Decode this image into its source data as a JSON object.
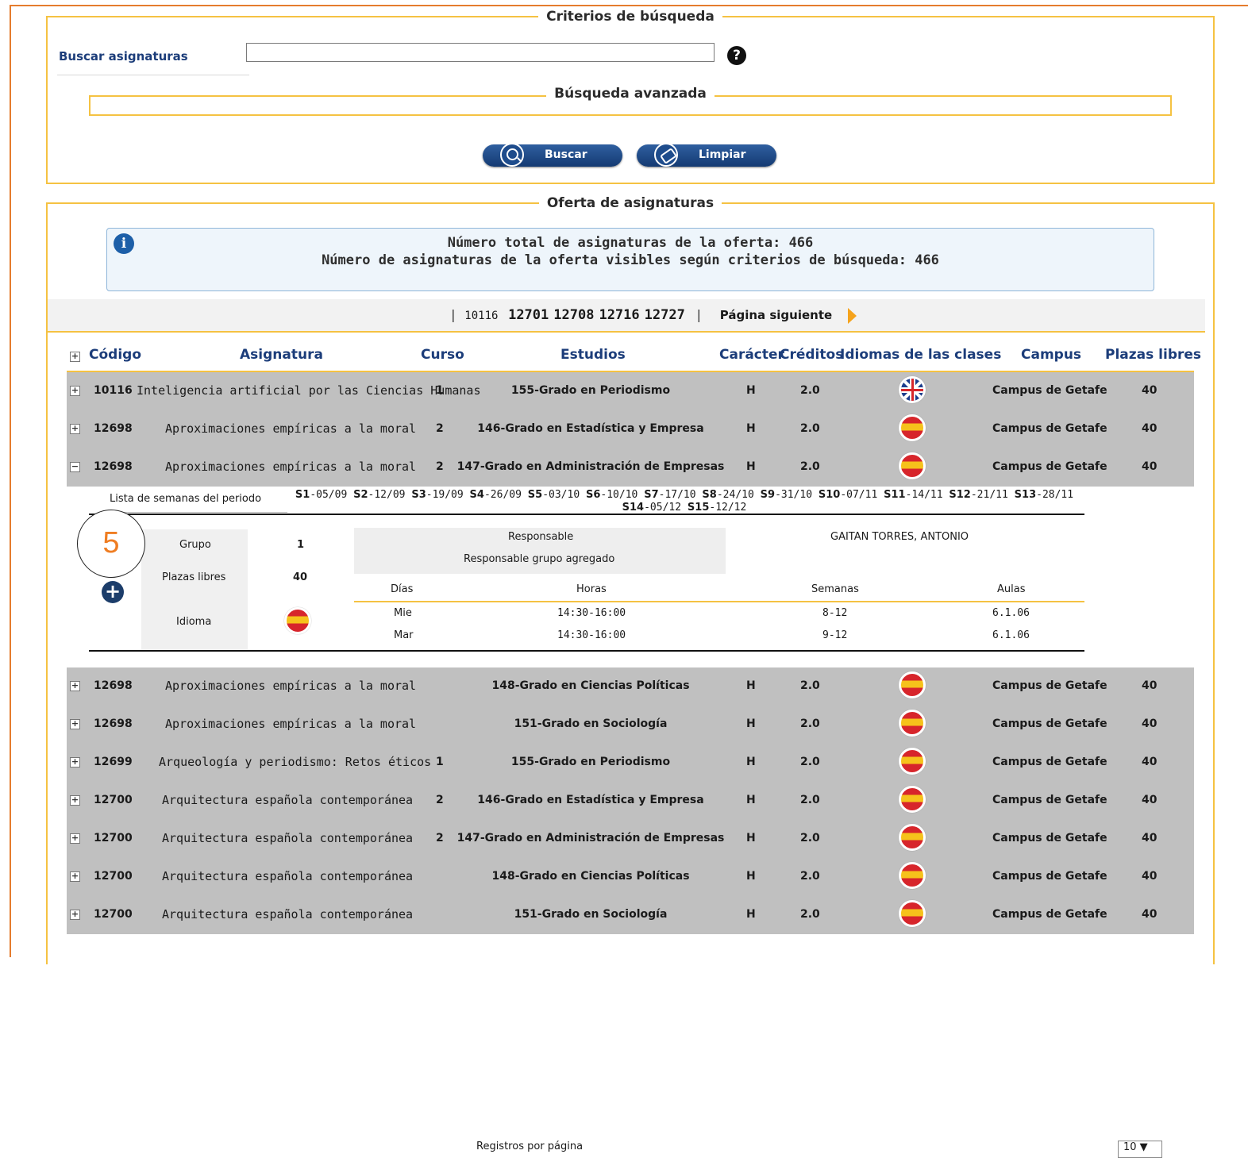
{
  "criteria": {
    "title": "Criterios de búsqueda",
    "search_label": "Buscar asignaturas",
    "search_value": "",
    "help": "?",
    "advanced_title": "Búsqueda avanzada",
    "btn_search": "Buscar",
    "btn_clear": "Limpiar"
  },
  "offer": {
    "title": "Oferta de asignaturas",
    "info_line1": "Número total de asignaturas de la oferta: 466",
    "info_line2": "Número de asignaturas de la oferta visibles según criterios de búsqueda: 466",
    "info_icon": "i",
    "pager": {
      "current": "10116",
      "pages": [
        "12701",
        "12708",
        "12716",
        "12727"
      ],
      "next": "Página siguiente"
    },
    "columns": [
      "Código",
      "Asignatura",
      "Curso",
      "Estudios",
      "Carácter",
      "Créditos",
      "Idiomas de las clases",
      "Campus",
      "Plazas libres"
    ],
    "rows_top": [
      {
        "expander": "+",
        "code": "10116",
        "name": "Inteligencia artificial por las Ciencias Humanas",
        "curso": "1",
        "estudios": "155-Grado en Periodismo",
        "caracter": "H",
        "creditos": "2.0",
        "idioma": "en-flag-icon",
        "campus": "Campus de Getafe",
        "plazas": "40"
      },
      {
        "expander": "+",
        "code": "12698",
        "name": "Aproximaciones empíricas a la moral",
        "curso": "2",
        "estudios": "146-Grado en Estadística y Empresa",
        "caracter": "H",
        "creditos": "2.0",
        "idioma": "es-flag-icon",
        "campus": "Campus de Getafe",
        "plazas": "40"
      },
      {
        "expander": "−",
        "code": "12698",
        "name": "Aproximaciones empíricas a la moral",
        "curso": "2",
        "estudios": "147-Grado en Administración de Empresas",
        "caracter": "H",
        "creditos": "2.0",
        "idioma": "es-flag-icon",
        "campus": "Campus de Getafe",
        "plazas": "40"
      }
    ],
    "detail": {
      "weeks_label": "Lista de semanas del periodo",
      "weeks_line1": [
        "S1",
        "-05/09",
        "S2",
        "-12/09",
        "S3",
        "-19/09",
        "S4",
        "-26/09",
        "S5",
        "-03/10",
        "S6",
        "-10/10",
        "S7",
        "-17/10",
        "S8",
        "-24/10",
        "S9",
        "-31/10",
        "S10",
        "-07/11",
        "S11",
        "-14/11",
        "S12",
        "-21/11",
        "S13",
        "-28/11"
      ],
      "weeks_line2": [
        "S14",
        "-05/12",
        "S15",
        "-12/12"
      ],
      "grupo_label": "Grupo",
      "grupo_value": "1",
      "plazas_label": "Plazas libres",
      "plazas_value": "40",
      "idioma_label": "Idioma",
      "responsable_label": "Responsable",
      "responsable_agregado_label": "Responsable grupo agregado",
      "responsable_value": "GAITAN TORRES, ANTONIO",
      "sched_headers": [
        "Días",
        "Horas",
        "Semanas",
        "Aulas"
      ],
      "schedule": [
        {
          "dia": "Mie",
          "horas": "14:30-16:00",
          "semanas": "8-12",
          "aula": "6.1.06"
        },
        {
          "dia": "Mar",
          "horas": "14:30-16:00",
          "semanas": "9-12",
          "aula": "6.1.06"
        }
      ]
    },
    "rows_bottom": [
      {
        "expander": "+",
        "code": "12698",
        "name": "Aproximaciones empíricas a la moral",
        "curso": "",
        "estudios": "148-Grado en Ciencias Políticas",
        "caracter": "H",
        "creditos": "2.0",
        "idioma": "es-flag-icon",
        "campus": "Campus de Getafe",
        "plazas": "40"
      },
      {
        "expander": "+",
        "code": "12698",
        "name": "Aproximaciones empíricas a la moral",
        "curso": "",
        "estudios": "151-Grado en Sociología",
        "caracter": "H",
        "creditos": "2.0",
        "idioma": "es-flag-icon",
        "campus": "Campus de Getafe",
        "plazas": "40"
      },
      {
        "expander": "+",
        "code": "12699",
        "name": "Arqueología y periodismo: Retos éticos",
        "curso": "1",
        "estudios": "155-Grado en Periodismo",
        "caracter": "H",
        "creditos": "2.0",
        "idioma": "es-flag-icon",
        "campus": "Campus de Getafe",
        "plazas": "40"
      },
      {
        "expander": "+",
        "code": "12700",
        "name": "Arquitectura española contemporánea",
        "curso": "2",
        "estudios": "146-Grado en Estadística y Empresa",
        "caracter": "H",
        "creditos": "2.0",
        "idioma": "es-flag-icon",
        "campus": "Campus de Getafe",
        "plazas": "40"
      },
      {
        "expander": "+",
        "code": "12700",
        "name": "Arquitectura española contemporánea",
        "curso": "2",
        "estudios": "147-Grado en Administración de Empresas",
        "caracter": "H",
        "creditos": "2.0",
        "idioma": "es-flag-icon",
        "campus": "Campus de Getafe",
        "plazas": "40"
      },
      {
        "expander": "+",
        "code": "12700",
        "name": "Arquitectura española contemporánea",
        "curso": "",
        "estudios": "148-Grado en Ciencias Políticas",
        "caracter": "H",
        "creditos": "2.0",
        "idioma": "es-flag-icon",
        "campus": "Campus de Getafe",
        "plazas": "40"
      },
      {
        "expander": "+",
        "code": "12700",
        "name": "Arquitectura española contemporánea",
        "curso": "",
        "estudios": "151-Grado en Sociología",
        "caracter": "H",
        "creditos": "2.0",
        "idioma": "es-flag-icon",
        "campus": "Campus de Getafe",
        "plazas": "40"
      }
    ],
    "records_per_page_label": "Registros por página",
    "records_per_page_value": "10 ▼"
  },
  "step_badge": "5",
  "add_icon": "+"
}
